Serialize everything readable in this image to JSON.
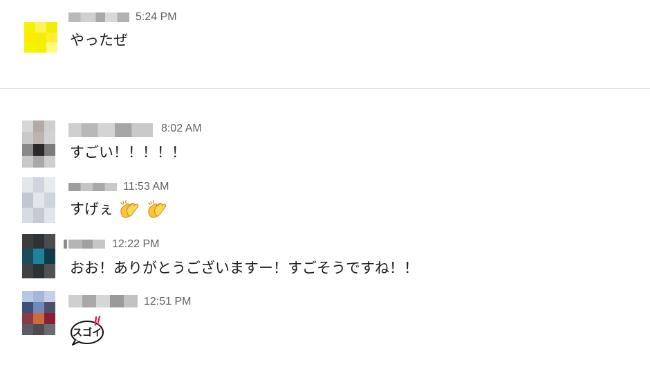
{
  "messages": [
    {
      "time": "5:24 PM",
      "text": "やったぜ",
      "avatar_colors": [
        "#f6f200",
        "#fff15a",
        "#f3f000",
        "#ffe900",
        "#f3ef00",
        "#ffef2c",
        "#f5f400",
        "#f6f000",
        "#fffa7d"
      ]
    },
    {
      "time": "8:02 AM",
      "text": "すごい！！！！！",
      "avatar_colors": [
        "#d0d0d0",
        "#b3a9a6",
        "#cfcfcf",
        "#8a8888",
        "#2a2828",
        "#7c7a7a",
        "#c9c9c9",
        "#a8a8a8",
        "#cfcfcf"
      ]
    },
    {
      "time": "11:53 AM",
      "text": "すげぇ",
      "reaction_emoji": "clapping-hands",
      "avatar_colors": [
        "#dfe3ea",
        "#cfd6e0",
        "#e7eaef",
        "#c2c8d2",
        "#e3e7ec",
        "#cfd5dd",
        "#d7dce4",
        "#c4cad4",
        "#e1e5eb"
      ]
    },
    {
      "time": "12:22 PM",
      "text": "おお！ありがとうございますー！すごそうですね！！",
      "avatar_colors": [
        "#3b3d3f",
        "#2f3235",
        "#4a4c4f",
        "#1b4c5c",
        "#20829a",
        "#0f3a48",
        "#3f4244",
        "#2e3133",
        "#505356"
      ]
    },
    {
      "time": "12:51 PM",
      "sticker": "スゴイ!!",
      "avatar_colors": [
        "#b8c7e3",
        "#7189bb",
        "#a6b6d6",
        "#3c4f79",
        "#7f6a83",
        "#4d4f6b",
        "#8c3b45",
        "#cc6c3e",
        "#8a1e32",
        "#5a5d66",
        "#4f4a52",
        "#6a6b72"
      ]
    }
  ],
  "colors": {
    "text": "#1d1c1d",
    "timestamp": "#616061",
    "divider": "#dddddd",
    "sticker_accent": "#e01e5a"
  }
}
